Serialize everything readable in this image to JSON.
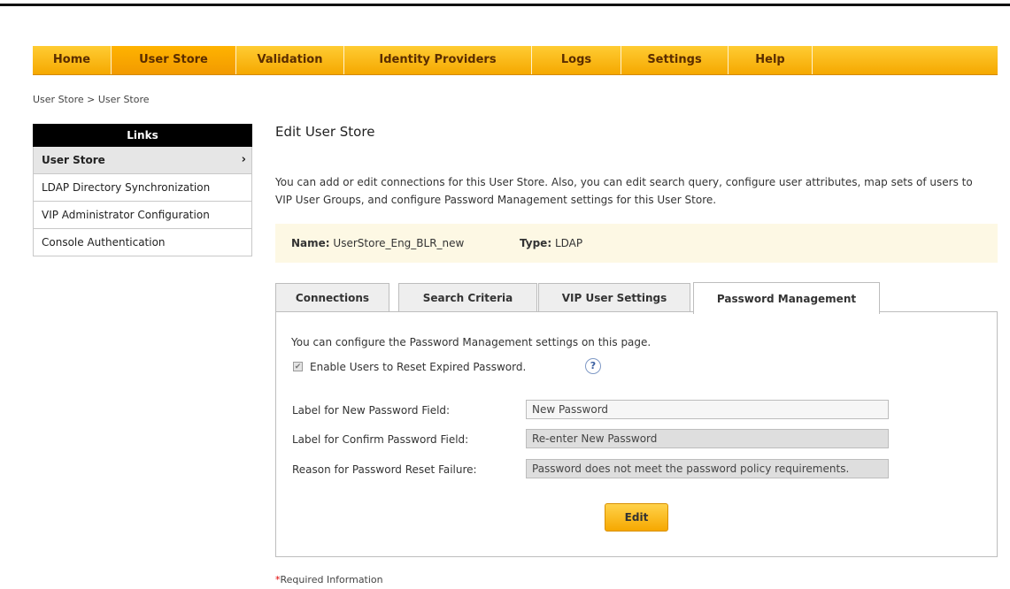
{
  "nav": {
    "items": [
      {
        "label": "Home"
      },
      {
        "label": "User Store"
      },
      {
        "label": "Validation"
      },
      {
        "label": "Identity Providers"
      },
      {
        "label": "Logs"
      },
      {
        "label": "Settings"
      },
      {
        "label": "Help"
      }
    ],
    "active": "User Store"
  },
  "breadcrumb": {
    "parent": "User Store",
    "separator": ">",
    "current": "User Store"
  },
  "sidebar": {
    "header": "Links",
    "items": [
      {
        "label": "User Store",
        "active": true
      },
      {
        "label": "LDAP Directory Synchronization"
      },
      {
        "label": "VIP Administrator Configuration"
      },
      {
        "label": "Console Authentication"
      }
    ],
    "chevron": "›"
  },
  "main": {
    "title": "Edit User Store",
    "intro": "You can add or edit connections for this User Store. Also, you can edit search query, configure user attributes, map sets of users to VIP User Groups, and configure Password Management settings for this User Store.",
    "info": {
      "name_label": "Name:",
      "name_value": "UserStore_Eng_BLR_new",
      "type_label": "Type:",
      "type_value": "LDAP"
    },
    "tabs": [
      {
        "label": "Connections"
      },
      {
        "label": "Search Criteria"
      },
      {
        "label": "VIP User Settings"
      },
      {
        "label": "Password Management",
        "active": true
      }
    ]
  },
  "password_management": {
    "intro": "You can configure the Password Management settings on this page.",
    "checkbox_label": "Enable Users to Reset Expired Password.",
    "checkbox_checked": true,
    "help_icon": "?",
    "fields": [
      {
        "label": "Label for New Password Field:",
        "value": "New Password"
      },
      {
        "label": "Label for Confirm Password Field:",
        "value": "Re-enter New Password"
      },
      {
        "label": "Reason for Password Reset Failure:",
        "value": "Password does not meet the password policy requirements."
      }
    ],
    "edit_button": "Edit"
  },
  "footer": {
    "required_star": "*",
    "required_text": "Required Information"
  },
  "colors": {
    "nav_bar": "#ffbf1a",
    "nav_text": "#5a2d00",
    "sidebar_header": "#000000",
    "info_bar": "#fdf8e4",
    "button": "#f6b400",
    "required_star": "#e00000"
  },
  "icons": {
    "sidebar_active": "chevron-right-icon",
    "help": "help-circle-icon",
    "checkbox": "checkbox-checked-icon"
  }
}
